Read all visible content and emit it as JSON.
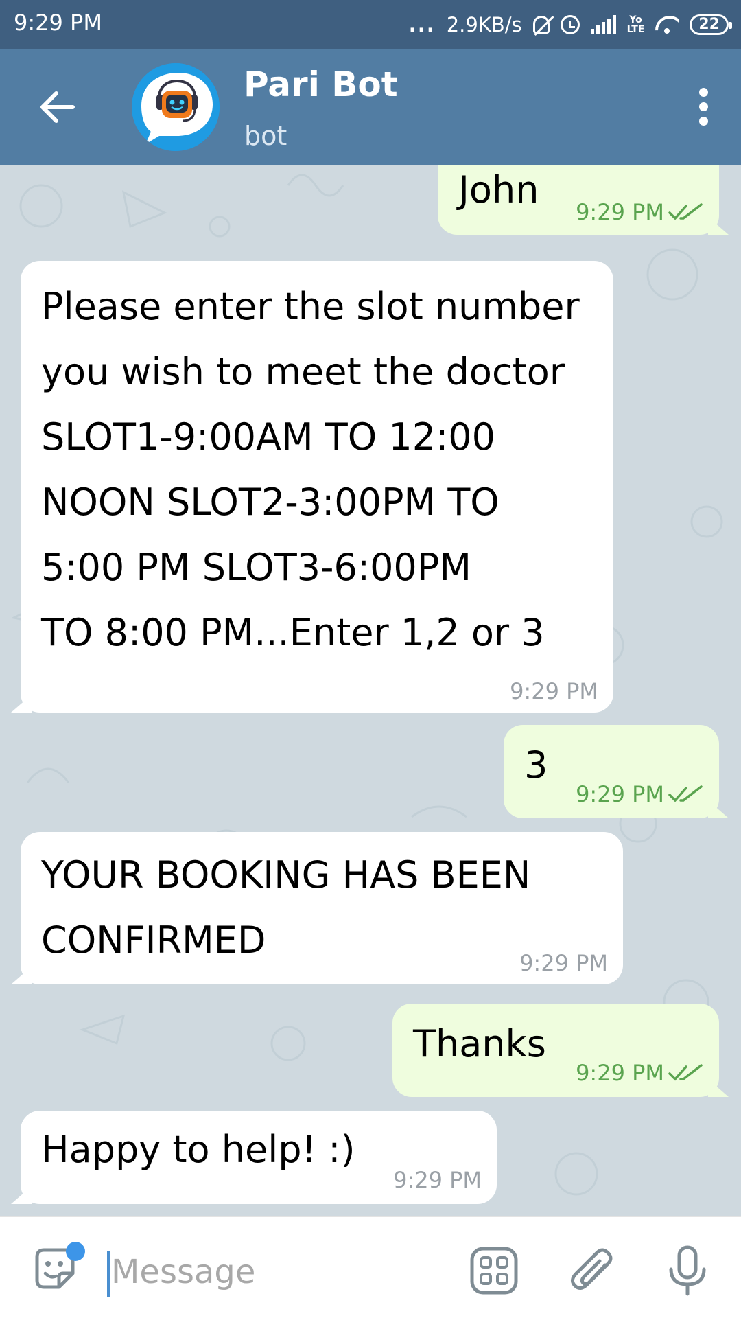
{
  "status_bar": {
    "time": "9:29 PM",
    "dots": "...",
    "net_speed": "2.9KB/s",
    "volte_top": "Yo",
    "volte_bottom": "LTE",
    "battery": "22"
  },
  "header": {
    "title": "Pari Bot",
    "subtitle": "bot"
  },
  "messages": [
    {
      "direction": "out",
      "text": "John",
      "time": "9:29 PM"
    },
    {
      "direction": "in",
      "lines": [
        "Please enter the slot number",
        "you wish to meet the doctor",
        "SLOT1-9:00AM TO 12:00",
        "NOON   SLOT2-3:00PM TO",
        "5:00 PM   SLOT3-6:00PM",
        "TO 8:00 PM...Enter 1,2 or 3"
      ],
      "time": "9:29 PM"
    },
    {
      "direction": "out",
      "text": "3",
      "time": "9:29 PM"
    },
    {
      "direction": "in",
      "lines": [
        "YOUR BOOKING HAS BEEN",
        "CONFIRMED"
      ],
      "time": "9:29 PM"
    },
    {
      "direction": "out",
      "text": "Thanks",
      "time": "9:29 PM"
    },
    {
      "direction": "in",
      "lines": [
        "Happy to help! :)"
      ],
      "time": "9:29 PM"
    }
  ],
  "input": {
    "placeholder": "Message"
  },
  "colors": {
    "header": "#527da3",
    "status_bar": "#3f5f80",
    "outgoing_bubble": "#effdde",
    "incoming_bubble": "#ffffff",
    "read_ticks": "#5aa44f"
  }
}
